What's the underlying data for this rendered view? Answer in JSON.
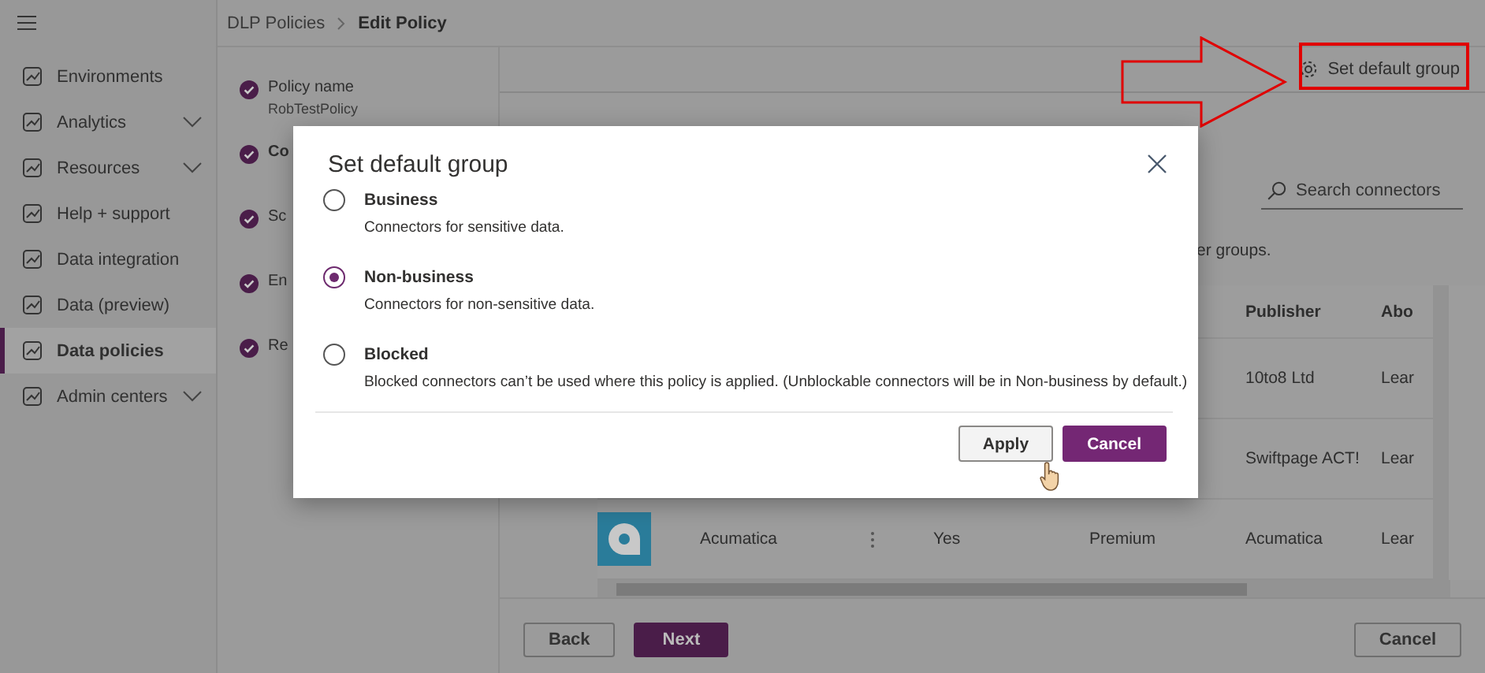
{
  "breadcrumb": [
    "DLP Policies",
    "Edit Policy"
  ],
  "sidebar": {
    "items": [
      {
        "label": "Environments",
        "selected": false,
        "expandable": false
      },
      {
        "label": "Analytics",
        "selected": false,
        "expandable": true
      },
      {
        "label": "Resources",
        "selected": false,
        "expandable": true
      },
      {
        "label": "Help + support",
        "selected": false,
        "expandable": false
      },
      {
        "label": "Data integration",
        "selected": false,
        "expandable": false
      },
      {
        "label": "Data (preview)",
        "selected": false,
        "expandable": false
      },
      {
        "label": "Data policies",
        "selected": true,
        "expandable": false
      },
      {
        "label": "Admin centers",
        "selected": false,
        "expandable": true
      }
    ]
  },
  "steps": [
    {
      "label": "Policy name",
      "value": "RobTestPolicy",
      "selected": false
    },
    {
      "label": "Co",
      "selected": true
    },
    {
      "label": "Sc",
      "selected": false
    },
    {
      "label": "En",
      "selected": false
    },
    {
      "label": "Re",
      "selected": false
    }
  ],
  "toolbar": {
    "button": "Set default group",
    "highlighted": true
  },
  "search": {
    "placeholder": "Search connectors"
  },
  "description": "er groups.",
  "table": {
    "columns": [
      "Publisher",
      "Abo"
    ],
    "rows": [
      {
        "has_logo": false,
        "cells": {
          "publisher": "10to8 Ltd",
          "column_7": "Lear"
        }
      },
      {
        "has_logo": false,
        "cells": {
          "publisher": "Swiftpage ACT!",
          "column_7": "Lear"
        }
      },
      {
        "has_logo": true,
        "cells": {
          "column_2": "Acumatica",
          "column_4": "Yes",
          "column_5": "Premium",
          "publisher": "Acumatica",
          "column_7": "Lear"
        }
      }
    ]
  },
  "footer": {
    "buttons": [
      {
        "label": "Back",
        "kind": "secondary"
      },
      {
        "label": "Next",
        "kind": "primary"
      },
      {
        "label": "Cancel",
        "kind": "secondary"
      }
    ]
  },
  "dialog": {
    "title": "Set default group",
    "options": [
      {
        "label": "Business",
        "description": "Connectors for sensitive data.",
        "selected": false
      },
      {
        "label": "Non-business",
        "description": "Connectors for non-sensitive data.",
        "selected": true
      },
      {
        "label": "Blocked",
        "description": "Blocked connectors can’t be used where this policy is applied. (Unblockable connectors will be in Non-business by default.)",
        "selected": false
      }
    ],
    "buttons": [
      {
        "label": "Apply",
        "kind": "secondary"
      },
      {
        "label": "Cancel",
        "kind": "primary"
      }
    ]
  }
}
